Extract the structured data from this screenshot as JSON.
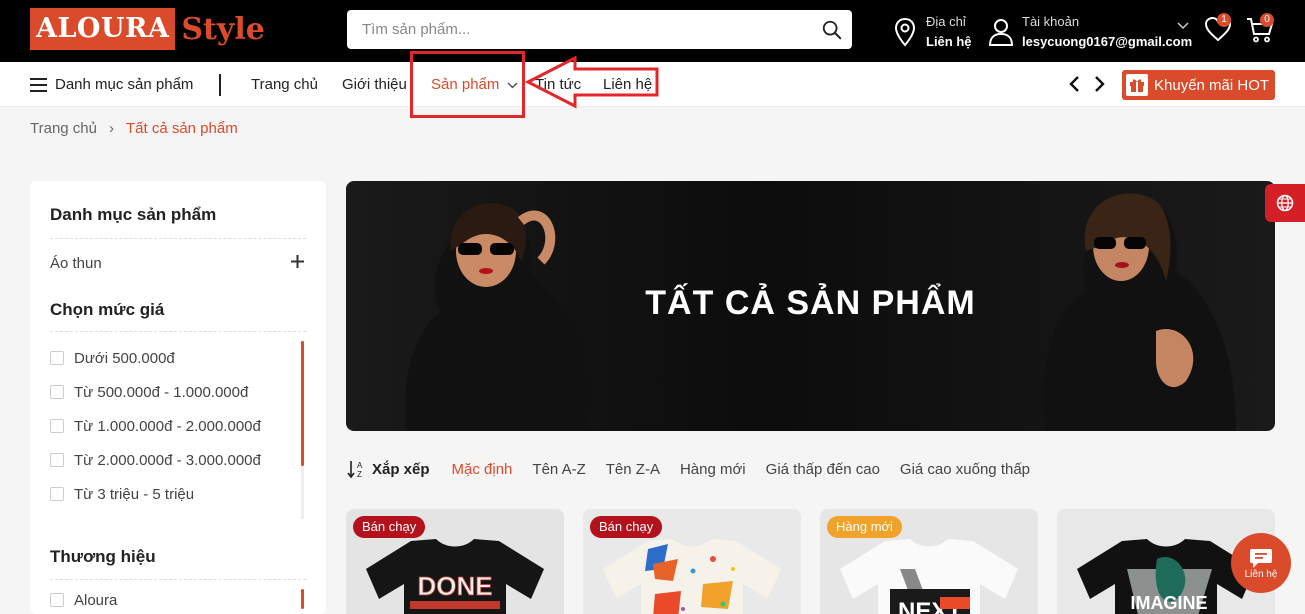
{
  "header": {
    "logo_part1": "ALOURA",
    "logo_part2": "Style",
    "search_placeholder": "Tìm sản phẩm...",
    "address_label": "Địa chỉ",
    "address_value": "Liên hệ",
    "account_label": "Tài khoản",
    "account_email": "lesycuong0167@gmail.com",
    "wishlist_count": "1",
    "cart_count": "0"
  },
  "nav": {
    "category_menu": "Danh mục sản phẩm",
    "links": [
      "Trang chủ",
      "Giới thiệu",
      "Sản phẩm",
      "Tin tức",
      "Liên hệ"
    ],
    "promo": "Khuyến mãi HOT"
  },
  "breadcrumb": {
    "home": "Trang chủ",
    "separator": "›",
    "current": "Tất cả sản phẩm"
  },
  "sidebar": {
    "category_title": "Danh mục sản phẩm",
    "categories": [
      "Áo thun"
    ],
    "price_title": "Chọn mức giá",
    "prices": [
      "Dưới 500.000đ",
      "Từ 500.000đ - 1.000.000đ",
      "Từ 1.000.000đ - 2.000.000đ",
      "Từ 2.000.000đ - 3.000.000đ",
      "Từ 3 triệu - 5 triệu"
    ],
    "brand_title": "Thương hiệu",
    "brands": [
      "Aloura"
    ]
  },
  "banner": {
    "title": "TẤT CẢ SẢN PHẨM"
  },
  "sort": {
    "label": "Xắp xếp",
    "options": [
      "Mặc định",
      "Tên A-Z",
      "Tên Z-A",
      "Hàng mới",
      "Giá thấp đến cao",
      "Giá cao xuống thấp"
    ]
  },
  "products": [
    {
      "tag": "Bán chạy",
      "print": "DONE"
    },
    {
      "tag": "Bán chạy",
      "print": ""
    },
    {
      "tag": "Hàng mới",
      "print": "NEXT"
    },
    {
      "tag": "",
      "print": "IMAGINE"
    }
  ],
  "floating": {
    "contact_label": "Liên hệ"
  },
  "colors": {
    "accent": "#d94b2b",
    "annotation": "#e3262a",
    "hot_tag": "#b3121c",
    "new_tag": "#f0a22a"
  }
}
